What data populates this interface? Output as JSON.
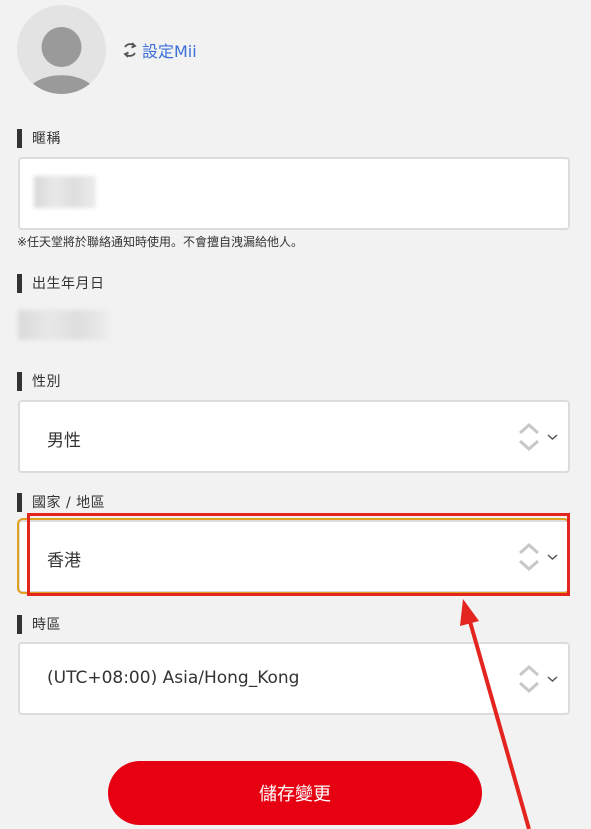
{
  "profile": {
    "mii_link": "設定Mii",
    "icons": {
      "avatar": "person-avatar",
      "refresh": "refresh-icon"
    }
  },
  "nickname": {
    "label": "暱稱",
    "value_redacted": true,
    "note": "※任天堂將於聯絡通知時使用。不會擅自洩漏給他人。"
  },
  "birthday": {
    "label": "出生年月日",
    "value_redacted": true
  },
  "gender": {
    "label": "性別",
    "selected": "男性"
  },
  "region": {
    "label": "國家 / 地區",
    "selected": "香港"
  },
  "timezone": {
    "label": "時區",
    "selected": "(UTC+08:00) Asia/Hong_Kong"
  },
  "actions": {
    "save_label": "儲存變更"
  },
  "colors": {
    "accent": "#e60012",
    "link": "#3a6fd8",
    "highlight": "#e3241f"
  }
}
